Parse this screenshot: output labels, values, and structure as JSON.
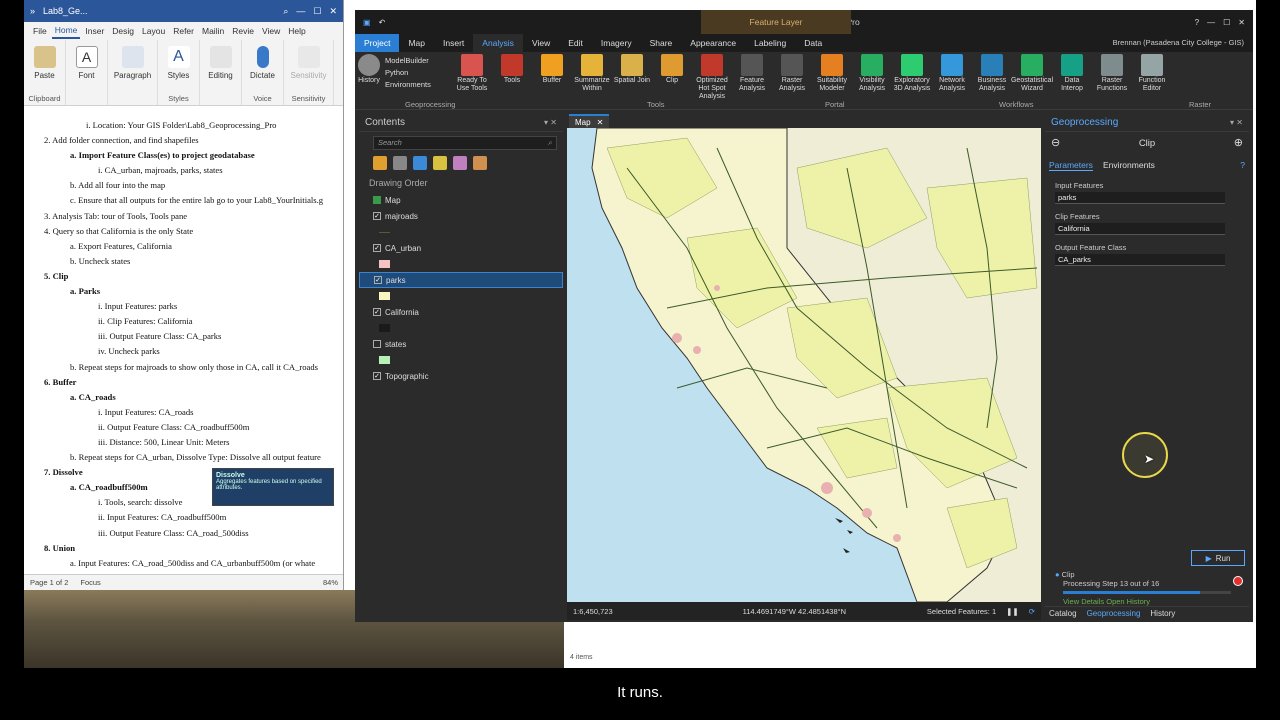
{
  "caption": "It runs.",
  "word": {
    "title": "Lab8_Ge...",
    "tabs": [
      "File",
      "Home",
      "Inser",
      "Desig",
      "Layou",
      "Refer",
      "Mailin",
      "Revie",
      "View",
      "Help"
    ],
    "groups": [
      "Paste",
      "Font",
      "Paragraph",
      "Styles",
      "Editing",
      "Dictate",
      "Sensitivity"
    ],
    "group_labels": [
      "Clipboard",
      "Styles",
      "Voice",
      "Sensitivity"
    ],
    "lines": [
      "i.    Location: Your GIS Folder\\Lab8_Geoprocessing_Pro",
      "2.   Add folder connection, and find shapefiles",
      "a.   Import Feature Class(es) to project geodatabase",
      "i.    CA_urban, majroads, parks, states",
      "b.   Add all four into the map",
      "c.   Ensure that all outputs for the entire lab go to your Lab8_YourInitials.g",
      "3.   Analysis Tab: tour of Tools, Tools pane",
      "4.   Query so that California is the only State",
      "a.   Export Features, California",
      "b.   Uncheck states",
      "5.   Clip",
      "a.   Parks",
      "i.    Input Features: parks",
      "ii.   Clip Features: California",
      "iii.  Output Feature Class: CA_parks",
      "iv.  Uncheck parks",
      "b.   Repeat steps for majroads to show only those in CA, call it CA_roads",
      "6.   Buffer",
      "a.   CA_roads",
      "i.    Input Features: CA_roads",
      "ii.   Output Feature Class: CA_roadbuff500m",
      "iii.  Distance: 500, Linear Unit: Meters",
      "b.   Repeat steps for CA_urban, Dissolve Type: Dissolve all output feature",
      "7.   Dissolve",
      "a.   CA_roadbuff500m",
      "i.    Tools, search: dissolve",
      "ii.   Input Features: CA_roadbuff500m",
      "iii.  Output Feature Class: CA_road_500diss",
      "8.   Union",
      "a.   Input Features: CA_road_500diss and CA_urbanbuff500m (or whate"
    ],
    "dissolve_thumb_title": "Dissolve",
    "dissolve_thumb_text": "Aggregates features based on specified attributes.",
    "status_page": "Page 1 of 2",
    "status_focus": "Focus",
    "zoom": "84%"
  },
  "arcgis": {
    "title": "Lab8_BW - Map - ArcGIS Pro",
    "context": "Feature Layer",
    "user": "Brennan (Pasadena City College - GIS)",
    "tabs": [
      "Project",
      "Map",
      "Insert",
      "Analysis",
      "View",
      "Edit",
      "Imagery",
      "Share",
      "Appearance",
      "Labeling",
      "Data"
    ],
    "ribbon_buttons": [
      {
        "label": "History",
        "color": "#8a8a8a"
      },
      {
        "label": "Ready To Use Tools",
        "color": "#d9534f"
      },
      {
        "label": "Tools",
        "color": "#c0392b"
      },
      {
        "label": "Buffer",
        "color": "#f0a020"
      },
      {
        "label": "Summarize Within",
        "color": "#e5b23a"
      },
      {
        "label": "Spatial Join",
        "color": "#d9b04a"
      },
      {
        "label": "Clip",
        "color": "#e09b30"
      },
      {
        "label": "Optimized Hot Spot Analysis",
        "color": "#c0392b"
      },
      {
        "label": "Feature Analysis",
        "color": "#555555"
      },
      {
        "label": "Raster Analysis",
        "color": "#555555"
      },
      {
        "label": "Suitability Modeler",
        "color": "#e67e22"
      },
      {
        "label": "Visibility Analysis",
        "color": "#27ae60"
      },
      {
        "label": "Exploratory 3D Analysis",
        "color": "#2ecc71"
      },
      {
        "label": "Network Analysis",
        "color": "#3498db"
      },
      {
        "label": "Business Analysis",
        "color": "#2980b9"
      },
      {
        "label": "Geostatistical Wizard",
        "color": "#27ae60"
      },
      {
        "label": "Data Interop",
        "color": "#16a085"
      },
      {
        "label": "Raster Functions",
        "color": "#7f8c8d"
      },
      {
        "label": "Function Editor",
        "color": "#95a5a6"
      }
    ],
    "small_buttons": [
      "ModelBuilder",
      "Python",
      "Environments"
    ],
    "ribbon_groups": [
      "Geoprocessing",
      "Tools",
      "Portal",
      "Workflows",
      "Raster"
    ],
    "contents": {
      "title": "Contents",
      "search_placeholder": "Search",
      "drawing_order": "Drawing Order",
      "layers": [
        {
          "name": "Map",
          "checked": false,
          "selected": false,
          "swatch": ""
        },
        {
          "name": "majroads",
          "checked": true,
          "selected": false,
          "swatch": "#5a5a3a"
        },
        {
          "name": "CA_urban",
          "checked": true,
          "selected": false,
          "swatch": "#f4c2c2"
        },
        {
          "name": "parks",
          "checked": true,
          "selected": true,
          "swatch": "#f8f6c0"
        },
        {
          "name": "California",
          "checked": true,
          "selected": false,
          "swatch": "#1a1a1a"
        },
        {
          "name": "states",
          "checked": false,
          "selected": false,
          "swatch": "#b8f0b8"
        },
        {
          "name": "Topographic",
          "checked": true,
          "selected": false,
          "swatch": ""
        }
      ]
    },
    "map": {
      "tab": "Map",
      "scale": "1:6,450,723",
      "coords": "114.4691749°W 42.4851438°N",
      "selected": "Selected Features: 1"
    },
    "geoprocessing": {
      "title": "Geoprocessing",
      "tool": "Clip",
      "tabs": [
        "Parameters",
        "Environments"
      ],
      "input_label": "Input Features",
      "input_value": "parks",
      "clip_label": "Clip Features",
      "clip_value": "California",
      "output_label": "Output Feature Class",
      "output_value": "CA_parks",
      "run": "Run",
      "progress_tool": "Clip",
      "progress_text": "Processing Step 13 out of 16",
      "progress": 0.8125,
      "view_details": "View Details",
      "open_history": "Open History",
      "footer_tabs": [
        "Catalog",
        "Geoprocessing",
        "History"
      ]
    },
    "below_text": "4 items"
  }
}
